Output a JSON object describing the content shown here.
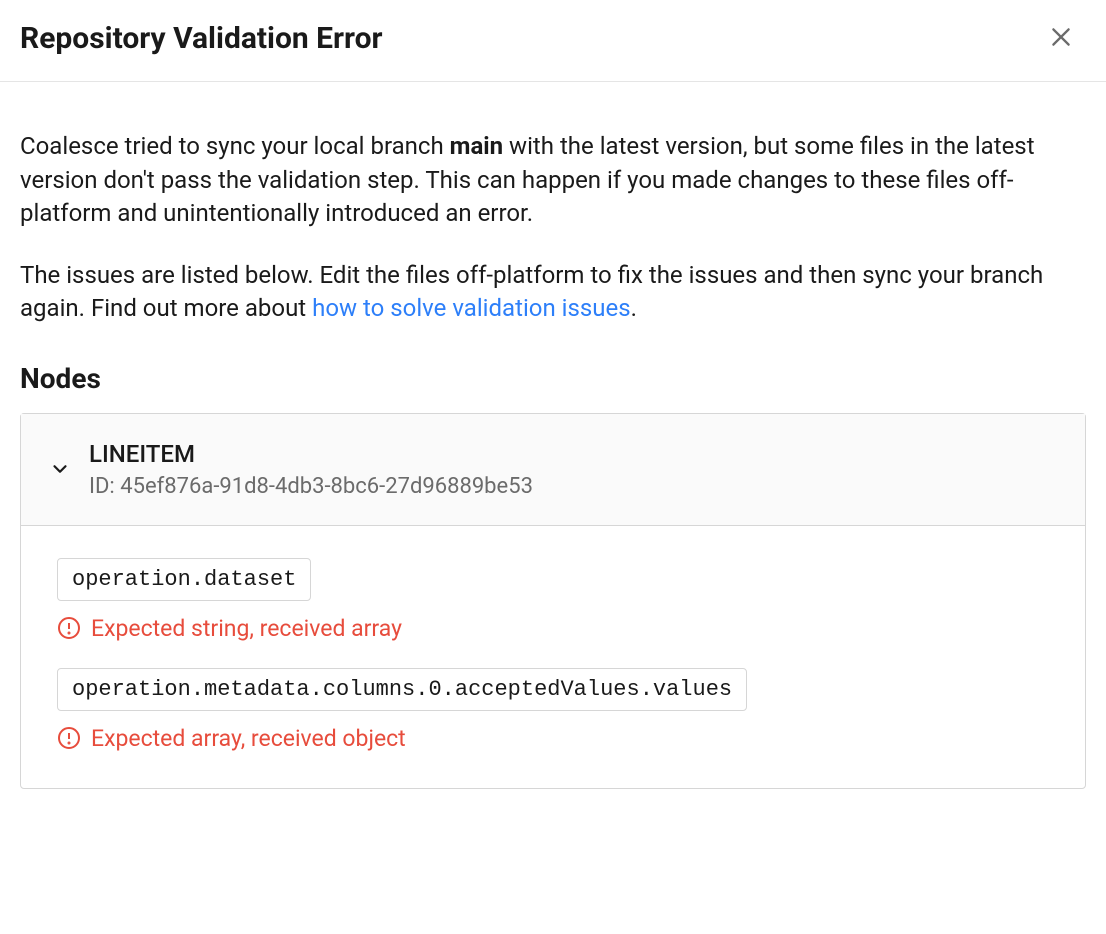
{
  "dialog": {
    "title": "Repository Validation Error"
  },
  "description": {
    "p1_prefix": "Coalesce tried to sync your local branch ",
    "branch": "main",
    "p1_suffix": " with the latest version, but some files in the latest version don't pass the validation step. This can happen if you made changes to these files off-platform and unintentionally introduced an error.",
    "p2_prefix": "The issues are listed below. Edit the files off-platform to fix the issues and then sync your branch again. Find out more about ",
    "link_text": "how to solve validation issues",
    "p2_suffix": "."
  },
  "section": {
    "heading": "Nodes"
  },
  "node": {
    "name": "LINEITEM",
    "id_label": "ID: ",
    "id": "45ef876a-91d8-4db3-8bc6-27d96889be53",
    "issues": [
      {
        "path": "operation.dataset",
        "message": "Expected string, received array"
      },
      {
        "path": "operation.metadata.columns.0.acceptedValues.values",
        "message": "Expected array, received object"
      }
    ]
  }
}
